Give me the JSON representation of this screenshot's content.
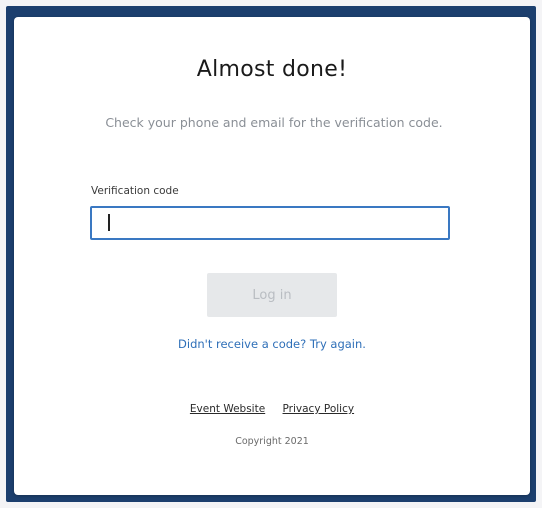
{
  "card": {
    "title": "Almost done!",
    "subtitle": "Check your phone and email for the verification code."
  },
  "form": {
    "code_label": "Verification code",
    "code_value": "",
    "login_label": "Log in",
    "retry_link": "Didn't receive a code? Try again."
  },
  "footer": {
    "links": [
      "Event Website",
      "Privacy Policy"
    ],
    "copyright": "Copyright 2021"
  },
  "colors": {
    "frame": "#1c3f6e",
    "accent": "#3a78c2",
    "link": "#2e6fb8",
    "button_disabled_bg": "#e6e8ea"
  }
}
